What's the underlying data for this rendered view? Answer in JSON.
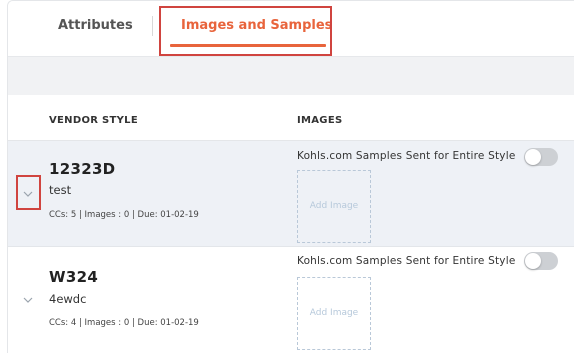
{
  "tabs": [
    {
      "label": "Attributes"
    },
    {
      "label": "Images and Samples"
    }
  ],
  "table": {
    "headers": {
      "vendor_style": "VENDOR STYLE",
      "images": "IMAGES"
    },
    "rows": [
      {
        "style": "12323D",
        "description": "test",
        "meta": "CCs: 5 | Images : 0 | Due: 01-02-19",
        "samples_label": "Kohls.com Samples Sent for Entire Style",
        "add_image": "Add Image"
      },
      {
        "style": "W324",
        "description": "4ewdc",
        "meta": "CCs: 4 | Images : 0 | Due: 01-02-19",
        "samples_label": "Kohls.com Samples Sent for Entire Style",
        "add_image": "Add Image"
      }
    ]
  },
  "icons": {
    "expand": "chevron-down-icon"
  },
  "colors": {
    "accent": "#e8643c",
    "highlight": "#d0443f",
    "row_selected_bg": "#eef1f6",
    "toggle_off": "#cdd0d4"
  }
}
